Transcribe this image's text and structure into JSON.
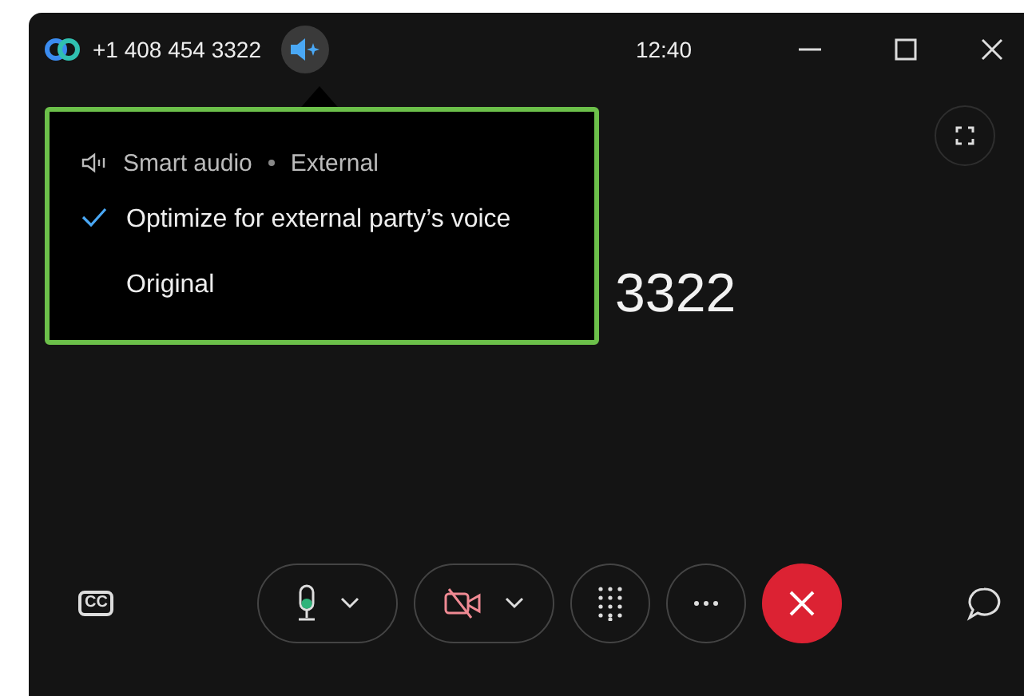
{
  "title_bar": {
    "phone_number": "+1 408 454 3322",
    "time": "12:40"
  },
  "audio_menu": {
    "header": "Smart audio",
    "header_value": "External",
    "options": [
      {
        "label": "Optimize for external party’s voice",
        "selected": true
      },
      {
        "label": "Original",
        "selected": false
      }
    ]
  },
  "call_number": "3322",
  "captions_button": {
    "label": "CC"
  },
  "controls": [
    {
      "kind": "mic"
    },
    {
      "kind": "video_off"
    },
    {
      "kind": "keypad"
    },
    {
      "kind": "more"
    },
    {
      "kind": "end_call"
    }
  ]
}
